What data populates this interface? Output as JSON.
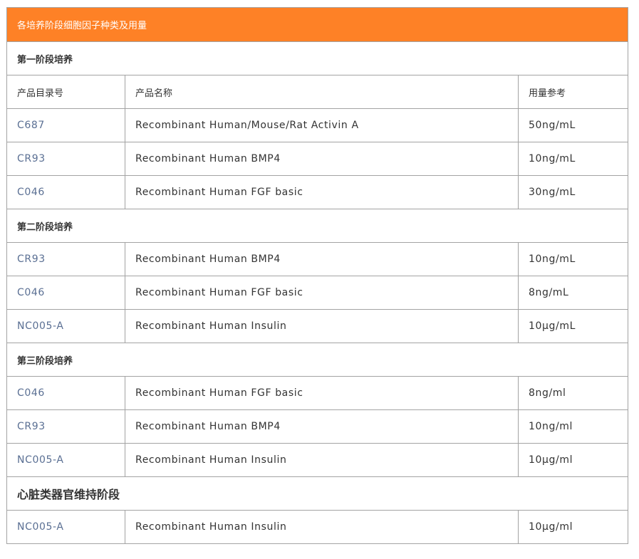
{
  "table_title": "各培养阶段细胞因子种类及用量",
  "columns": [
    "产品目录号",
    "产品名称",
    "用量参考"
  ],
  "stages": [
    {
      "label": "第一阶段培养",
      "rows": [
        {
          "catalog": "C687",
          "name": "Recombinant Human/Mouse/Rat Activin A",
          "dosage": "50ng/mL"
        },
        {
          "catalog": "CR93",
          "name": "Recombinant Human BMP4",
          "dosage": "10ng/mL"
        },
        {
          "catalog": "C046",
          "name": "Recombinant Human FGF basic",
          "dosage": "30ng/mL"
        }
      ]
    },
    {
      "label": "第二阶段培养",
      "rows": [
        {
          "catalog": "CR93",
          "name": "Recombinant Human BMP4",
          "dosage": "10ng/mL"
        },
        {
          "catalog": "C046",
          "name": "Recombinant Human FGF basic",
          "dosage": "8ng/mL"
        },
        {
          "catalog": "NC005-A",
          "name": "Recombinant Human Insulin",
          "dosage": "10μg/mL"
        }
      ]
    },
    {
      "label": "第三阶段培养",
      "rows": [
        {
          "catalog": "C046",
          "name": "Recombinant Human FGF basic",
          "dosage": "8ng/ml"
        },
        {
          "catalog": "CR93",
          "name": "Recombinant Human BMP4",
          "dosage": "10ng/ml"
        },
        {
          "catalog": "NC005-A",
          "name": "Recombinant Human Insulin",
          "dosage": "10μg/ml"
        }
      ]
    },
    {
      "label": "心脏类器官维持阶段",
      "rows": [
        {
          "catalog": "NC005-A",
          "name": "Recombinant Human Insulin",
          "dosage": "10μg/ml"
        }
      ]
    }
  ],
  "colors": {
    "title_bg": "#fe8126",
    "title_text": "#ffffff",
    "catalog_link": "#5a6f93",
    "border": "#a3a3a3"
  }
}
